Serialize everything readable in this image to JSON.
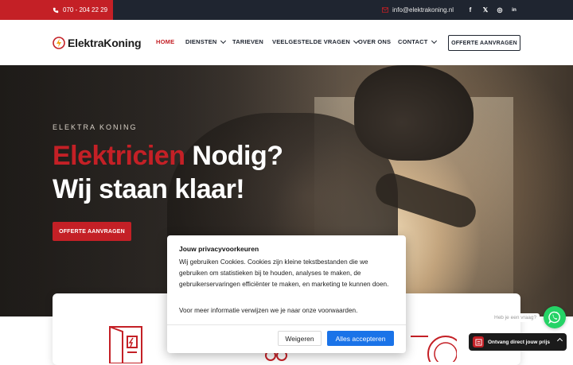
{
  "topbar": {
    "phone": "070 - 204 22 29",
    "email": "info@elektrakoning.nl",
    "social": [
      {
        "icon": "facebook-icon",
        "glyph": "f"
      },
      {
        "icon": "x-twitter-icon",
        "glyph": "𝕏"
      },
      {
        "icon": "instagram-icon",
        "glyph": "◎"
      },
      {
        "icon": "linkedin-icon",
        "glyph": "in"
      }
    ]
  },
  "header": {
    "logo_part1": "Elektra",
    "logo_part2": "Koning",
    "nav": {
      "home": "HOME",
      "diensten": "DIENSTEN",
      "tarieven": "TARIEVEN",
      "faq": "VEELGESTELDE VRAGEN",
      "over": "OVER ONS",
      "contact": "CONTACT"
    },
    "cta": "OFFERTE AANVRAGEN"
  },
  "hero": {
    "overline": "ELEKTRA KONING",
    "title_red": "Elektricien",
    "title_white": " Nodig?",
    "title_line2": "Wij staan klaar!",
    "button": "OFFERTE AANVRAGEN"
  },
  "cookie": {
    "title": "Jouw privacyvoorkeuren",
    "body": "Wij gebruiken Cookies. Cookies zijn kleine tekstbestanden die we gebruiken om statistieken bij te houden, analyses te maken, de gebruikerservaringen efficiënter te maken, en marketing te kunnen doen.",
    "more": "Voor meer informatie verwijzen we je naar onze voorwaarden.",
    "decline": "Weigeren",
    "accept": "Alles accepteren"
  },
  "widgets": {
    "whatsapp_bubble": "Heb je een vraag?",
    "price_cta": "Ontvang direct jouw prijs"
  },
  "colors": {
    "brand_red": "#c42026",
    "dark": "#1f2530",
    "accept_blue": "#1a73e8",
    "whatsapp_green": "#25d366"
  }
}
